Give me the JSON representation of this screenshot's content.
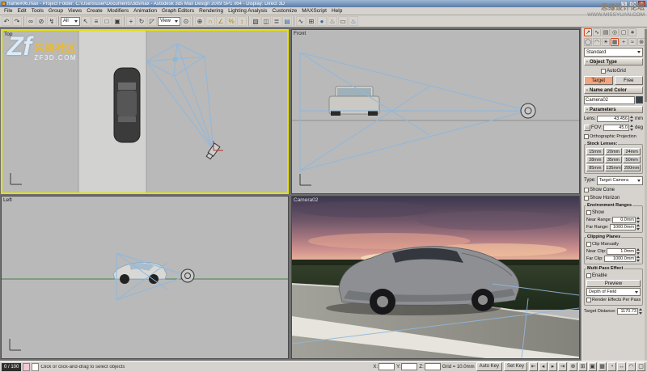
{
  "colors": {
    "active-viewport-border": "#e6e200",
    "target-button": "#f2a57e",
    "cone-line": "#8fb8dc",
    "watermark-yellow": "#e8b93a"
  },
  "titlebar": {
    "title": "frame#06.max - Project Folder: C:\\Users\\user\\Documents\\3dsmax - Autodesk 3ds Max Design 2009 SP1 x64 - Display: Direct 3D"
  },
  "window_buttons": {
    "minimize": "–",
    "maximize": "□",
    "close": "×"
  },
  "watermark_left": {
    "logo": "Zf",
    "title": "朱峰社区",
    "subtitle": "ZF3D.COM"
  },
  "watermark_right": {
    "line1": "思缘设计论坛",
    "line2": "WWW.MISSYUAN.COM"
  },
  "menu": {
    "items": [
      "File",
      "Edit",
      "Tools",
      "Group",
      "Views",
      "Create",
      "Modifiers",
      "Animation",
      "Graph Editors",
      "Rendering",
      "Lighting Analysis",
      "Customize",
      "MAXScript",
      "Help"
    ]
  },
  "toolbar": {
    "selection_filter": "All",
    "ref_coord": "View",
    "icons": [
      {
        "name": "undo-icon",
        "glyph": "↶"
      },
      {
        "name": "redo-icon",
        "glyph": "↷"
      },
      {
        "type": "sep"
      },
      {
        "name": "select-and-link-icon",
        "glyph": "∞"
      },
      {
        "name": "unlink-selection-icon",
        "glyph": "⊘"
      },
      {
        "name": "bind-to-space-warp-icon",
        "glyph": "↯"
      },
      {
        "type": "sep"
      },
      {
        "type": "dd",
        "name": "selection-filter-dropdown",
        "label_key": "selection_filter",
        "width": 24
      },
      {
        "name": "select-object-icon",
        "glyph": "↖"
      },
      {
        "name": "select-by-name-icon",
        "glyph": "≡"
      },
      {
        "name": "rectangular-selection-icon",
        "glyph": "□"
      },
      {
        "name": "window-crossing-icon",
        "glyph": "▣"
      },
      {
        "type": "sep"
      },
      {
        "name": "select-and-move-icon",
        "glyph": "+"
      },
      {
        "name": "select-and-rotate-icon",
        "glyph": "↻"
      },
      {
        "name": "select-and-scale-icon",
        "glyph": "◸"
      },
      {
        "type": "dd",
        "name": "reference-coordinate-dropdown",
        "label_key": "ref_coord",
        "width": 28
      },
      {
        "name": "use-pivot-point-icon",
        "glyph": "⊙"
      },
      {
        "type": "sep"
      },
      {
        "name": "select-and-manipulate-icon",
        "glyph": "⊕"
      },
      {
        "name": "snaps-toggle-icon",
        "glyph": "∩",
        "color": "#b08800"
      },
      {
        "name": "angle-snap-icon",
        "glyph": "∠",
        "color": "#b08800"
      },
      {
        "name": "percent-snap-icon",
        "glyph": "%",
        "color": "#b08800"
      },
      {
        "name": "spinner-snap-icon",
        "glyph": "↕",
        "color": "#b08800"
      },
      {
        "type": "sep"
      },
      {
        "name": "edit-named-selection-sets-icon",
        "glyph": "▧"
      },
      {
        "name": "mirror-icon",
        "glyph": "◫"
      },
      {
        "name": "align-icon",
        "glyph": "≣"
      },
      {
        "name": "layer-manager-icon",
        "glyph": "▤",
        "color": "#3a6ea8"
      },
      {
        "type": "sep"
      },
      {
        "name": "curve-editor-icon",
        "glyph": "∿"
      },
      {
        "name": "schematic-view-icon",
        "glyph": "⊞"
      },
      {
        "name": "material-editor-icon",
        "glyph": "●",
        "color": "#3a6ea8"
      },
      {
        "name": "render-setup-icon",
        "glyph": "♨",
        "color": "#555555"
      },
      {
        "name": "rendered-frame-window-icon",
        "glyph": "▭"
      },
      {
        "name": "quick-render-icon",
        "glyph": "♨",
        "color": "#2a66a0"
      }
    ]
  },
  "viewports": {
    "top_label": "Top",
    "front_label": "Front",
    "left_label": "Left",
    "camera_label": "Camera02"
  },
  "command_panel": {
    "tabs": [
      {
        "name": "create-tab-icon",
        "glyph": "↗",
        "active": true
      },
      {
        "name": "modify-tab-icon",
        "glyph": "∿"
      },
      {
        "name": "hierarchy-tab-icon",
        "glyph": "▤"
      },
      {
        "name": "motion-tab-icon",
        "glyph": "◎"
      },
      {
        "name": "display-tab-icon",
        "glyph": "▢"
      },
      {
        "name": "utilities-tab-icon",
        "glyph": "∗"
      }
    ],
    "categories": [
      {
        "name": "geometry-category-icon",
        "glyph": "◯"
      },
      {
        "name": "shapes-category-icon",
        "glyph": "◠"
      },
      {
        "name": "lights-category-icon",
        "glyph": "☀"
      },
      {
        "name": "cameras-category-icon",
        "glyph": "▦",
        "active": true
      },
      {
        "name": "helpers-category-icon",
        "glyph": "+"
      },
      {
        "name": "space-warps-category-icon",
        "glyph": "≈"
      },
      {
        "name": "systems-category-icon",
        "glyph": "⊛"
      }
    ],
    "class_dropdown": "Standard",
    "collapse_glyph": "-",
    "rollouts": {
      "object_type": "Object Type",
      "name_color": "Name and Color",
      "parameters": "Parameters"
    },
    "autogrid": "AutoGrid",
    "target_button": "Target",
    "free_button": "Free",
    "camera_name": "Camera02",
    "lens_label": "Lens:",
    "lens_value": "43.456",
    "lens_unit": "mm",
    "fov_direction_glyph": "↔",
    "fov_label": "FOV:",
    "fov_value": "45.0",
    "fov_unit": "deg",
    "orthographic": "Orthographic Projection",
    "stock_lenses_title": "Stock Lenses:",
    "lenses": [
      "15mm",
      "20mm",
      "24mm",
      "28mm",
      "35mm",
      "50mm",
      "85mm",
      "135mm",
      "200mm"
    ],
    "type_label": "Type:",
    "type_value": "Target Camera",
    "show_cone": "Show Cone",
    "show_horizon": "Show Horizon",
    "env_title": "Environment Ranges",
    "env_show": "Show",
    "near_range_label": "Near Range:",
    "near_range_value": "0.0mm",
    "far_range_label": "Far Range:",
    "far_range_value": "1000.0mm",
    "clip_title": "Clipping Planes",
    "clip_manually": "Clip Manually",
    "near_clip_label": "Near Clip:",
    "near_clip_value": "1.0mm",
    "far_clip_label": "Far Clip:",
    "far_clip_value": "1000.0mm",
    "multipass_title": "Multi-Pass Effect",
    "enable": "Enable",
    "preview": "Preview",
    "effect_dropdown": "Depth of Field",
    "render_per_pass": "Render Effects Per Pass",
    "target_distance_label": "Target Distance:",
    "target_distance_value": "1170.73"
  },
  "status_bar": {
    "frame_indicator": "0 / 100",
    "prompt": "Click or click-and-drag to select objects",
    "x_label": "X:",
    "y_label": "Y:",
    "z_label": "Z:",
    "grid": "Grid = 10.0mm",
    "auto_key": "Auto Key",
    "set_key": "Set Key",
    "playback_icons": [
      {
        "name": "go-to-start-icon",
        "glyph": "⇤"
      },
      {
        "name": "previous-frame-icon",
        "glyph": "◂"
      },
      {
        "name": "play-animation-icon",
        "glyph": "▸"
      },
      {
        "name": "go-to-end-icon",
        "glyph": "⇥"
      }
    ],
    "nav_icons": [
      {
        "name": "zoom-icon",
        "glyph": "⊕"
      },
      {
        "name": "zoom-all-icon",
        "glyph": "⊞"
      },
      {
        "name": "zoom-extents-icon",
        "glyph": "▣"
      },
      {
        "name": "zoom-extents-all-icon",
        "glyph": "▦"
      },
      {
        "name": "field-of-view-icon",
        "glyph": "◔"
      },
      {
        "name": "pan-icon",
        "glyph": "↔"
      },
      {
        "name": "arc-rotate-icon",
        "glyph": "◠"
      },
      {
        "name": "maximize-viewport-toggle-icon",
        "glyph": "▢"
      }
    ]
  }
}
